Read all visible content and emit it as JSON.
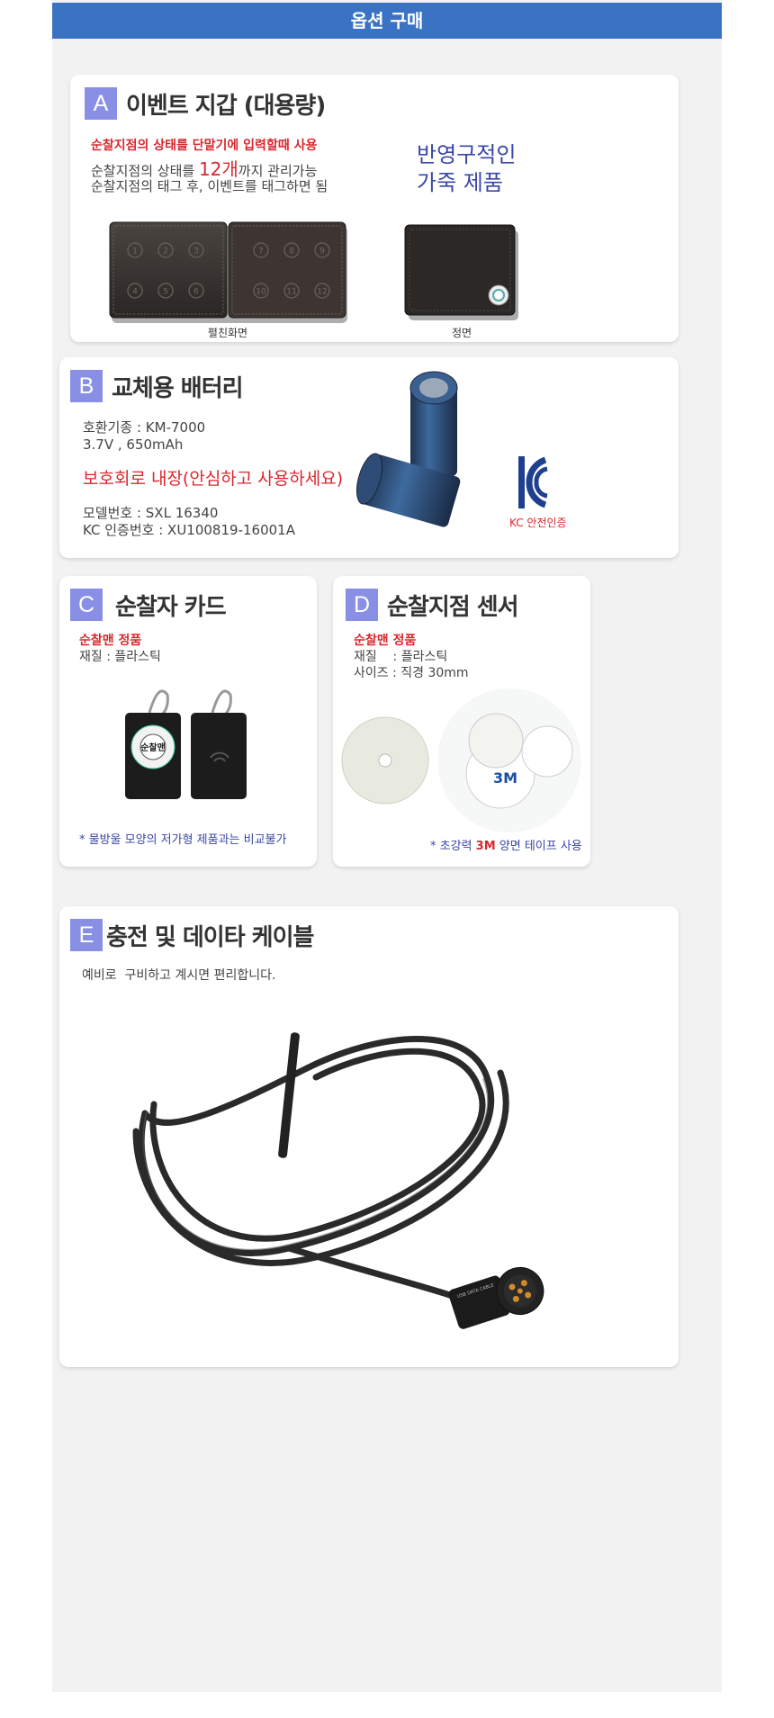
{
  "banner": {
    "title": "옵션 구매"
  },
  "cardA": {
    "letter": "A",
    "title": "이벤트 지갑 (대용량)",
    "line1": "순찰지점의 상태를 단말기에 입력할때 사용",
    "line2_pre": "순찰지점의 상태를 ",
    "line2_num": "12개",
    "line2_post": "까지 관리가능",
    "line3": "순찰지점의 태그 후, 이벤트를 태그하면 됨",
    "promo1": "반영구적인",
    "promo2": "가죽 제품",
    "wallet_open_nums": [
      "1",
      "2",
      "3",
      "4",
      "5",
      "6",
      "7",
      "8",
      "9",
      "10",
      "11",
      "12"
    ],
    "caption_open": "펼친화면",
    "caption_front": "정면"
  },
  "cardB": {
    "letter": "B",
    "title": "교체용 배터리",
    "compat": "호환기종 : KM-7000",
    "spec": "3.7V , 650mAh",
    "protect": "보호회로 내장(안심하고 사용하세요)",
    "model": "모델번호 : SXL 16340",
    "kc_num": "KC 인증번호 : XU100819-16001A",
    "kc_caption": "KC 안전인증"
  },
  "cardC": {
    "letter": "C",
    "title": "순찰자 카드",
    "brand": "순찰맨 정품",
    "material": "재질 : 플라스틱",
    "tag_logo": "순찰맨",
    "note": "* 물방울 모양의 저가형 제품과는 비교불가"
  },
  "cardD": {
    "letter": "D",
    "title": "순찰지점 센서",
    "brand": "순찰맨 정품",
    "material": "재질    : 플라스틱",
    "size": "사이즈 : 직경 30mm",
    "note_pre": "* 초강력 ",
    "note_3m": "3M",
    "note_post": " 양면 테이프 사용"
  },
  "cardE": {
    "letter": "E",
    "title": "충전 및 데이타 케이블",
    "desc": "예비로  구비하고 계시면 편리합니다.",
    "plug_label": "USB DATA CABLE"
  },
  "colors": {
    "banner": "#3a73c3",
    "letter_box": "#8a8fe6",
    "accent_red": "#d9272e",
    "accent_blue": "#3a47a8",
    "kc_blue": "#1f3f8f"
  }
}
